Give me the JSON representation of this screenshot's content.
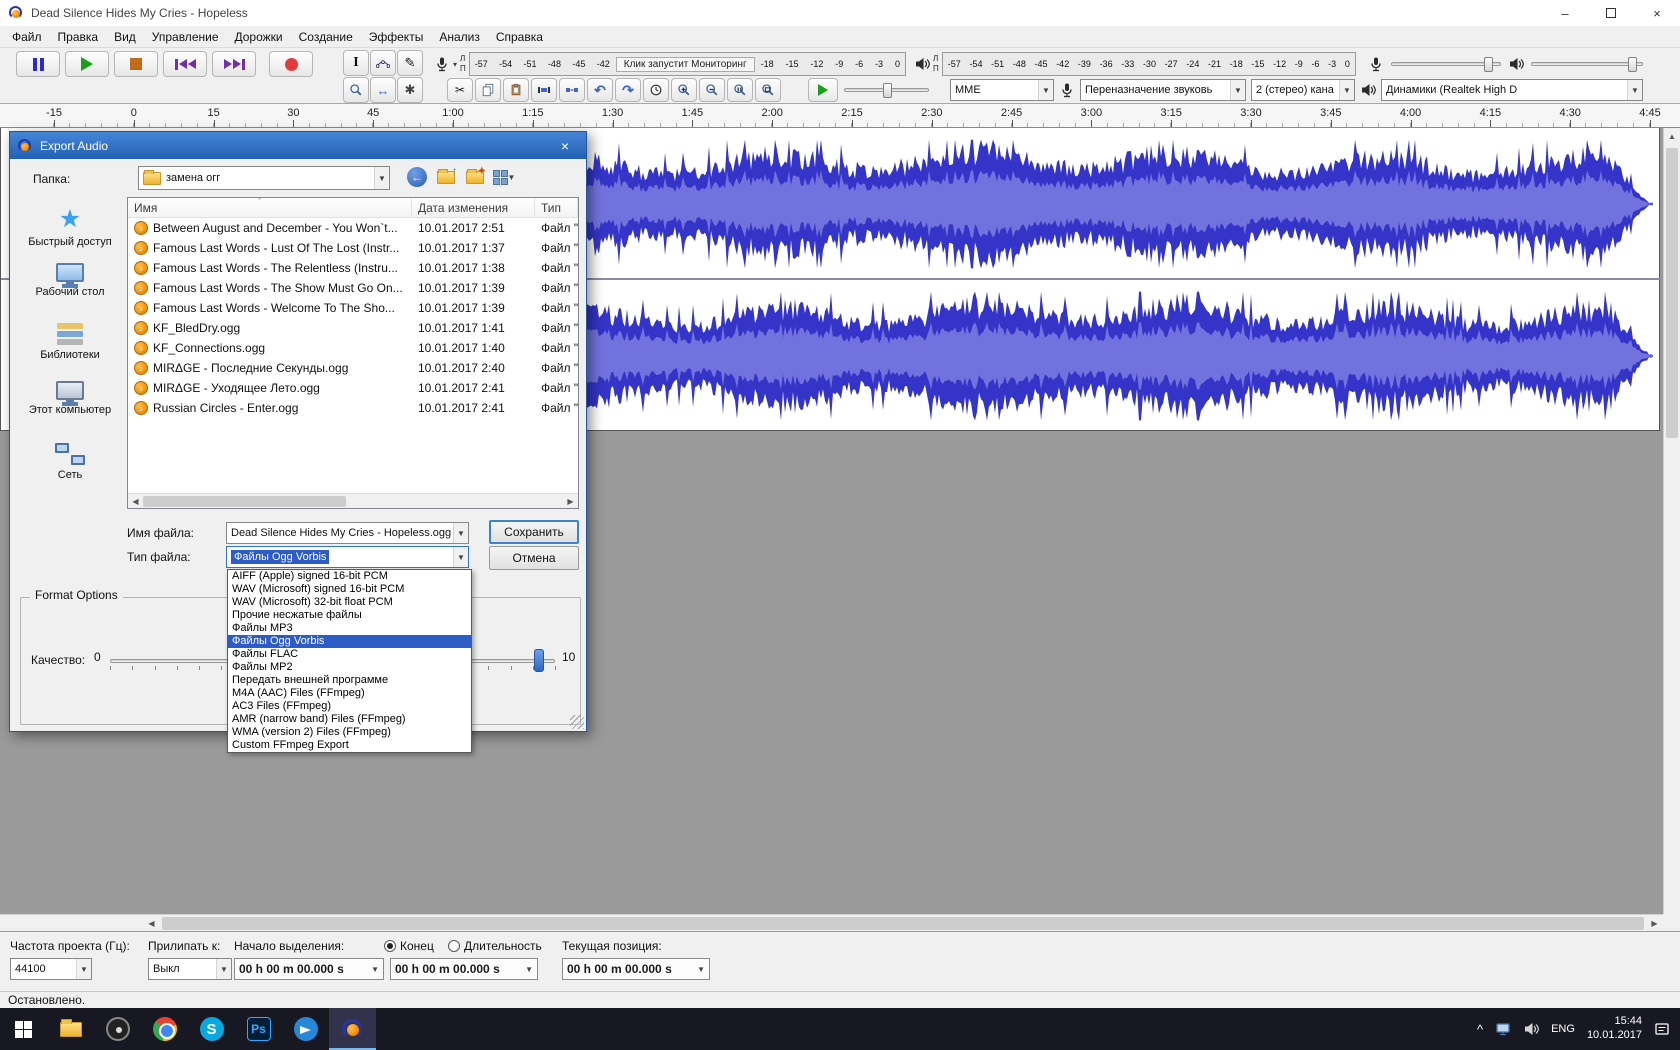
{
  "titlebar": {
    "title": "Dead Silence Hides My Cries - Hopeless"
  },
  "menu": {
    "items": [
      "Файл",
      "Правка",
      "Вид",
      "Управление",
      "Дорожки",
      "Создание",
      "Эффекты",
      "Анализ",
      "Справка"
    ]
  },
  "meters": {
    "record": {
      "scale_left": [
        "-57",
        "-54",
        "-51",
        "-48",
        "-45",
        "-42"
      ],
      "monitor_text": "Клик запустит Мониторинг",
      "scale_right": [
        "-18",
        "-15",
        "-12",
        "-9",
        "-6",
        "-3",
        "0"
      ],
      "channels": [
        "Л",
        "П"
      ]
    },
    "play": {
      "scale": [
        "-57",
        "-54",
        "-51",
        "-48",
        "-45",
        "-42",
        "-39",
        "-36",
        "-33",
        "-30",
        "-27",
        "-24",
        "-21",
        "-18",
        "-15",
        "-12",
        "-9",
        "-6",
        "-3",
        "0"
      ],
      "channels": [
        "Л",
        "П"
      ]
    }
  },
  "device_toolbar": {
    "host": "MME",
    "recording_device": "Переназначение звуковь",
    "channels": "2 (стерео) кана",
    "playback_device": "Динамики (Realtek High D"
  },
  "timeline": {
    "labels": [
      "-15",
      "0",
      "15",
      "30",
      "45",
      "1:00",
      "1:15",
      "1:30",
      "1:45",
      "2:00",
      "2:15",
      "2:30",
      "2:45",
      "3:00",
      "3:15",
      "3:30",
      "3:45",
      "4:00",
      "4:15",
      "4:30",
      "4:45"
    ]
  },
  "waveform": {
    "peak_color": "#3434c8",
    "rms_color": "#7272de",
    "background": "#ffffff"
  },
  "dialog": {
    "title": "Export Audio",
    "folder_label": "Папка:",
    "folder_value": "замена огг",
    "places": [
      "Быстрый доступ",
      "Рабочий стол",
      "Библиотеки",
      "Этот компьютер",
      "Сеть"
    ],
    "columns": [
      "Имя",
      "Дата изменения",
      "Тип"
    ],
    "files": [
      {
        "name": "Between August and December - You Won`t...",
        "date": "10.01.2017 2:51",
        "type": "Файл \"OG"
      },
      {
        "name": "Famous Last Words - Lust Of The Lost (Instr...",
        "date": "10.01.2017 1:37",
        "type": "Файл \"OG"
      },
      {
        "name": "Famous Last Words - The Relentless (Instru...",
        "date": "10.01.2017 1:38",
        "type": "Файл \"OG"
      },
      {
        "name": "Famous Last Words - The Show Must Go On...",
        "date": "10.01.2017 1:39",
        "type": "Файл \"OG"
      },
      {
        "name": "Famous Last Words - Welcome To The Sho...",
        "date": "10.01.2017 1:39",
        "type": "Файл \"OG"
      },
      {
        "name": "KF_BledDry.ogg",
        "date": "10.01.2017 1:41",
        "type": "Файл \"OG"
      },
      {
        "name": "KF_Connections.ogg",
        "date": "10.01.2017 1:40",
        "type": "Файл \"OG"
      },
      {
        "name": "MIRΔGE - Последние Секунды.ogg",
        "date": "10.01.2017 2:40",
        "type": "Файл \"OG"
      },
      {
        "name": "MIRΔGE - Уходящее Лето.ogg",
        "date": "10.01.2017 2:41",
        "type": "Файл \"OG"
      },
      {
        "name": "Russian Circles - Enter.ogg",
        "date": "10.01.2017 2:41",
        "type": "Файл \"OG"
      }
    ],
    "filename_label": "Имя файла:",
    "filename_value": "Dead Silence Hides My Cries - Hopeless.ogg",
    "filetype_label": "Тип файла:",
    "filetype_value": "Файлы Ogg Vorbis",
    "save_button": "Сохранить",
    "cancel_button": "Отмена",
    "type_options": [
      "AIFF (Apple) signed 16-bit PCM",
      "WAV (Microsoft) signed 16-bit PCM",
      "WAV (Microsoft) 32-bit float PCM",
      "Прочие несжатые файлы",
      "Файлы MP3",
      "Файлы Ogg Vorbis",
      "Файлы FLAC",
      "Файлы MP2",
      "Передать внешней программе",
      "M4A (AAC) Files (FFmpeg)",
      "AC3 Files (FFmpeg)",
      "AMR (narrow band) Files (FFmpeg)",
      "WMA (version 2) Files (FFmpeg)",
      "Custom FFmpeg Export"
    ],
    "selected_type": "Файлы Ogg Vorbis",
    "format_options": {
      "title": "Format Options",
      "quality_label": "Качество:",
      "min": "0",
      "max": "10"
    }
  },
  "selection_toolbar": {
    "rate_label": "Частота проекта (Гц):",
    "rate_value": "44100",
    "snap_label": "Прилипать к:",
    "snap_value": "Выкл",
    "selection_label": "Начало выделения:",
    "radio_end": "Конец",
    "radio_duration": "Длительность",
    "position_label": "Текущая позиция:",
    "times": [
      "00 h 00 m 00.000 s",
      "00 h 00 m 00.000 s",
      "00 h 00 m 00.000 s"
    ]
  },
  "statusbar": {
    "text": "Остановлено."
  },
  "taskbar": {
    "language": "ENG",
    "time": "15:44",
    "date": "10.01.2017"
  }
}
